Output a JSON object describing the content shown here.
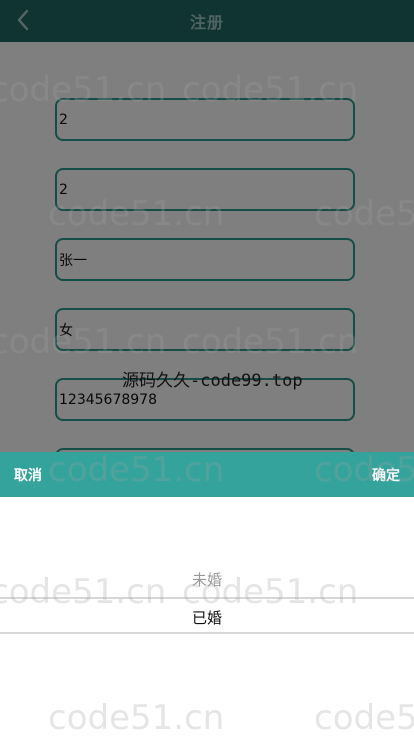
{
  "header": {
    "title": "注册",
    "back_icon": "chevron-left-icon"
  },
  "form": {
    "fields": [
      {
        "value": "2"
      },
      {
        "value": "2"
      },
      {
        "value": "张一"
      },
      {
        "value": "女"
      },
      {
        "value": "12345678978"
      },
      {
        "value": ""
      }
    ]
  },
  "picker": {
    "cancel_label": "取消",
    "confirm_label": "确定",
    "options": [
      "未婚",
      "已婚"
    ],
    "selected": "已婚"
  },
  "watermarks": {
    "center": "源码久久-code99.top",
    "repeat": "code51.cn"
  },
  "colors": {
    "header": "#1f6864",
    "accent": "#33a39b",
    "field_border": "#2f9a8f"
  }
}
